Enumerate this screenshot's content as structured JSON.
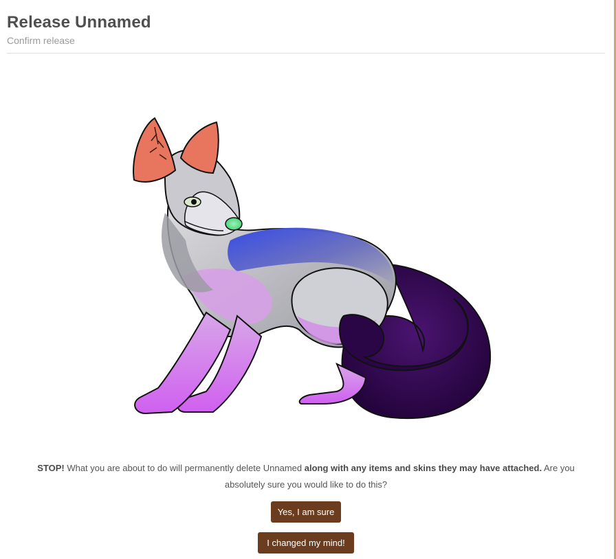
{
  "header": {
    "title": "Release Unnamed",
    "subtitle": "Confirm release"
  },
  "pet": {
    "image_alt": "Unnamed",
    "colors": {
      "ear_inner": "#e6735c",
      "body_gray": "#c8c8cc",
      "back_blue": "#3a4bdc",
      "chest_pink": "#d79ee6",
      "legs_magenta": "#c860e8",
      "tail_purple": "#3a0a5a",
      "nose_green": "#56e08a"
    }
  },
  "warning": {
    "stop": "STOP!",
    "part1": " What you are about to do will permanently delete Unnamed ",
    "bold": "along with any items and skins they may have attached.",
    "part2": " Are you absolutely sure you would like to do this?"
  },
  "buttons": {
    "confirm": "Yes, I am sure",
    "cancel": "I changed my mind!"
  },
  "theme": {
    "button_bg": "#6b3d1e",
    "title_color": "#4f4f4f"
  }
}
